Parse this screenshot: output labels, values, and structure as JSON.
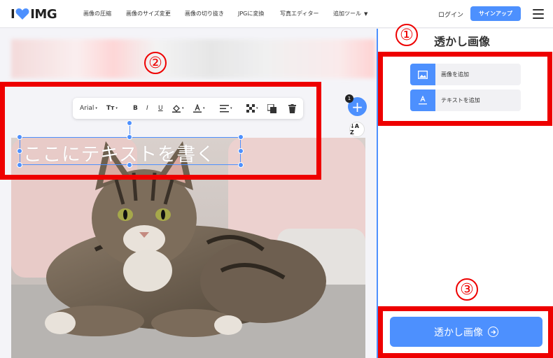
{
  "header": {
    "logo_left": "I",
    "logo_right": "IMG",
    "nav": [
      {
        "label": "画像の圧縮"
      },
      {
        "label": "画像のサイズ変更"
      },
      {
        "label": "画像の切り抜き"
      },
      {
        "label": "JPGに変換"
      },
      {
        "label": "写真エディター"
      },
      {
        "label": "追加ツール",
        "arrow": "▼"
      }
    ],
    "login": "ログイン",
    "signup": "サインアップ"
  },
  "toolbar": {
    "font": "Arial",
    "size_icon": "Tт",
    "bold": "B",
    "italic": "I",
    "underline": "U",
    "caret": "▾"
  },
  "canvas": {
    "text": "ここにテキストを書く",
    "layer_count": "1",
    "add_symbol": "+",
    "sort_label": "↓A Z"
  },
  "sidebar": {
    "title": "透かし画像",
    "add_image": "画像を追加",
    "add_text": "テキストを追加",
    "submit": "透かし画像"
  },
  "annotations": {
    "one": "①",
    "two": "②",
    "three": "③"
  },
  "colors": {
    "accent": "#4d90fe",
    "annotation": "#ee0000"
  }
}
